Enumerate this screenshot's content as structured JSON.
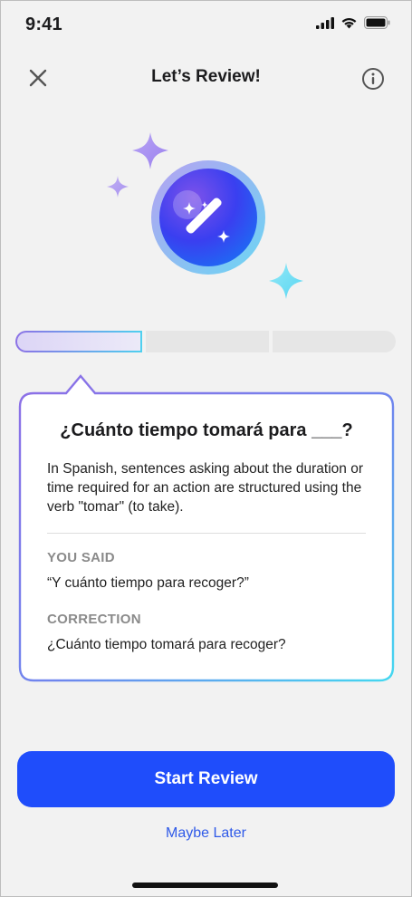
{
  "status_bar": {
    "time": "9:41",
    "icons": [
      "cellular-signal-icon",
      "wifi-icon",
      "battery-icon"
    ]
  },
  "nav": {
    "title": "Let’s Review!",
    "close_icon": "close-icon",
    "info_icon": "info-icon"
  },
  "hero": {
    "icon": "magic-wand-icon",
    "decorations": [
      "sparkle-icon",
      "sparkle-icon",
      "sparkle-icon"
    ]
  },
  "progress": {
    "segments": 3,
    "current": 1
  },
  "card": {
    "title": "¿Cuánto tiempo tomará para ___?",
    "explanation": "In Spanish, sentences asking about the duration or time required for an action are structured using the verb \"tomar\" (to take).",
    "you_said_label": "YOU SAID",
    "you_said_value": "“Y cuánto tiempo para recoger?”",
    "correction_label": "CORRECTION",
    "correction_value": "¿Cuánto tiempo tomará para recoger?"
  },
  "actions": {
    "start_label": "Start Review",
    "later_label": "Maybe Later"
  },
  "colors": {
    "background": "#f2f2f2",
    "primary_button": "#1f4dfb",
    "link": "#2f5ae8",
    "gradient_start": "#8d72e6",
    "gradient_end": "#4fd0ef"
  }
}
